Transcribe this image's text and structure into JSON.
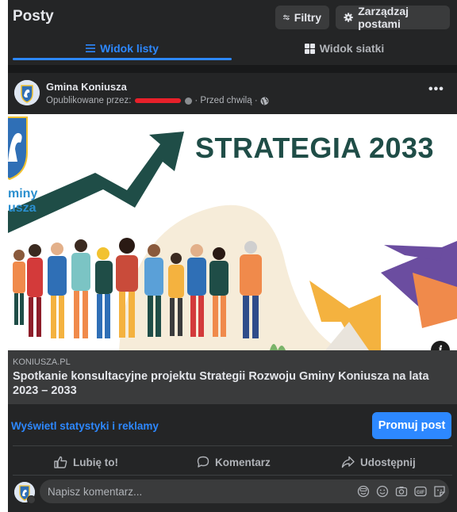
{
  "header": {
    "title": "Posty",
    "filter_label": "Filtry",
    "manage_label": "Zarządzaj postami"
  },
  "tabs": [
    {
      "label": "Widok listy",
      "active": true
    },
    {
      "label": "Widok siatki",
      "active": false
    }
  ],
  "post": {
    "author": "Gmina Koniusza",
    "published_by": "Opublikowane przez:",
    "time": "· Przed chwilą ·",
    "link": {
      "domain": "KONIUSZA.PL",
      "title": "Spotkanie konsultacyjne projektu Strategii Rozwoju Gminy Koniusza na lata 2023 – 2033",
      "image_headline": "STRATEGIA 2033",
      "image_logo_text_1": "miny",
      "image_logo_text_2": "usza"
    },
    "stats_link": "Wyświetl statystyki i reklamy",
    "promote_label": "Promuj post",
    "actions": {
      "like": "Lubię to!",
      "comment": "Komentarz",
      "share": "Udostępnij"
    },
    "comment_placeholder": "Napisz komentarz..."
  },
  "colors": {
    "background": "#18191a",
    "surface": "#242526",
    "accent": "#2d88ff",
    "headline": "#1f4d47"
  },
  "icons": [
    "filter-icon",
    "gear-icon",
    "list-icon",
    "grid-icon",
    "globe-icon",
    "info-icon",
    "like-icon",
    "comment-icon",
    "share-icon",
    "sticker-icon",
    "emoji-icon",
    "camera-icon",
    "gif-icon",
    "avatar-sticker-icon"
  ]
}
